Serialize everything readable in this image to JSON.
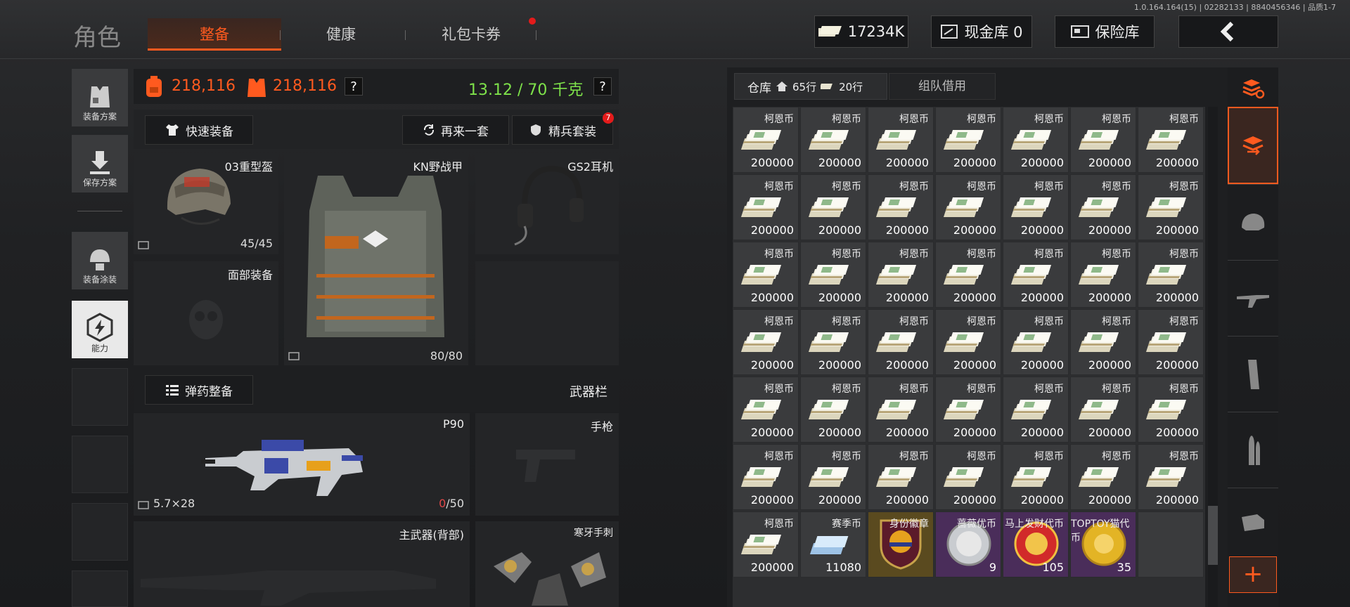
{
  "version": "1.0.164.164(15) | 02282133 | 8840456346 | 品质1-7",
  "page_title": "角色",
  "tabs": [
    {
      "label": "整备",
      "active": true
    },
    {
      "label": "健康",
      "active": false
    },
    {
      "label": "礼包卡券",
      "active": false,
      "red_dot": true
    }
  ],
  "top": {
    "currency_value": "17234K",
    "cash_vault_label": "现金库 0",
    "insurance_label": "保险库",
    "back_icon": "chevron-left-icon"
  },
  "sidebar": {
    "items": [
      {
        "label": "装备方案",
        "icon": "vest-icon"
      },
      {
        "label": "保存方案",
        "icon": "download-icon"
      },
      {
        "label": "装备涂装",
        "icon": "helmet-paint-icon"
      },
      {
        "label": "能力",
        "icon": "hex-lightning-icon"
      }
    ]
  },
  "stats": {
    "value1": "218,116",
    "value2": "218,116",
    "help1": "?",
    "weight": "13.12 / 70 千克",
    "help2": "?"
  },
  "buttons": {
    "quick_equip": "快速装备",
    "another_set": "再来一套",
    "elite_set": "精兵套装",
    "elite_badge": "7",
    "ammo_prep": "弹药整备"
  },
  "equipment": {
    "helmet": {
      "name": "03重型盔",
      "durability": "45/45"
    },
    "armor": {
      "name": "KN野战甲",
      "durability": "80/80"
    },
    "headset": {
      "name": "GS2耳机"
    },
    "face": {
      "name": "面部装备"
    },
    "weapon_bar_label": "武器栏",
    "primary": {
      "name": "P90",
      "caliber": "5.7×28",
      "ammo_current": "0",
      "ammo_max": "/50"
    },
    "pistol": {
      "name": "手枪"
    },
    "back_weapon": {
      "name": "主武器(背部)"
    },
    "melee": {
      "name": "寒牙手刺"
    }
  },
  "warehouse": {
    "tab_label": "仓库",
    "rows_label": "65行",
    "other_rows_label": "20行",
    "team_tab": "组队借用",
    "coin_name": "柯恩币",
    "coin_amount": "200000",
    "last_row": [
      {
        "name": "柯恩币",
        "count": "200000",
        "type": "coin"
      },
      {
        "name": "赛季币",
        "count": "11080",
        "type": "season"
      },
      {
        "name": "身份徽章",
        "count": "",
        "type": "badge"
      },
      {
        "name": "蔷薇优币",
        "count": "9",
        "type": "rose"
      },
      {
        "name": "马上发财代币",
        "count": "105",
        "type": "fortune"
      },
      {
        "name": "TOPTOY猫代币",
        "count": "35",
        "type": "toptoy"
      }
    ]
  },
  "right_nav": {
    "icons": [
      "stack-refresh-icon",
      "stack-transfer-icon",
      "helmet-icon",
      "rifle-icon",
      "magazine-icon",
      "bullet-icon",
      "scope-icon"
    ],
    "add_label": "+"
  },
  "colors": {
    "accent": "#ff5a1f",
    "green": "#7ee24a",
    "panel": "#242527"
  }
}
